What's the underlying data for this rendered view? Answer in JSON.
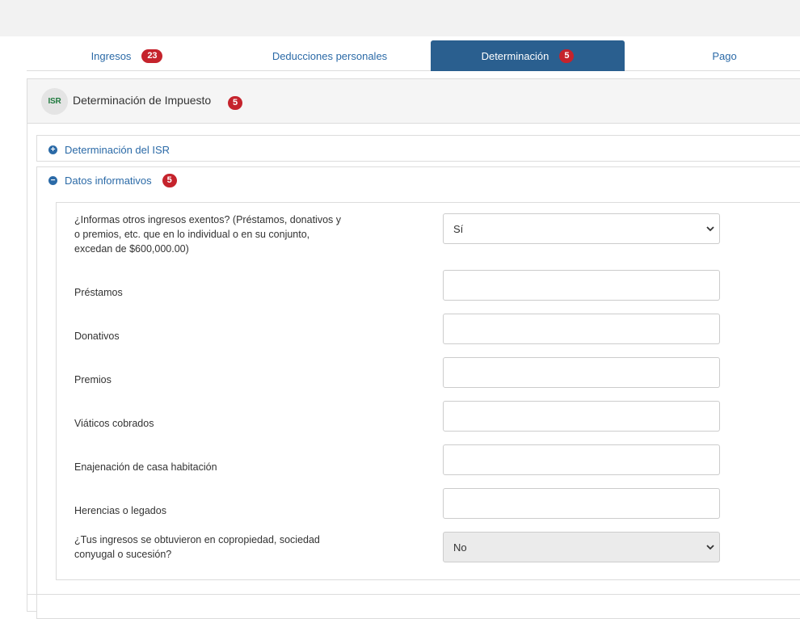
{
  "tabs": [
    {
      "label": "Ingresos",
      "badge": "23"
    },
    {
      "label": "Deducciones personales",
      "badge": ""
    },
    {
      "label": "Determinación",
      "badge": "5"
    },
    {
      "label": "Pago",
      "badge": ""
    }
  ],
  "panel": {
    "icon_text": "ISR",
    "title": "Determinación de Impuesto",
    "badge": "5"
  },
  "sections": {
    "determinacion": {
      "label": "Determinación del ISR",
      "icon": "plus-circle-icon"
    },
    "datos": {
      "label": "Datos informativos",
      "badge": "5",
      "icon": "minus-circle-icon"
    }
  },
  "form": {
    "q_otros": "¿Informas otros ingresos exentos? (Préstamos, donativos y o premios, etc. que en lo individual o en su conjunto, excedan de $600,000.00)",
    "q_otros_value": "Sí",
    "prestamos": "Préstamos",
    "prestamos_value": "",
    "donativos": "Donativos",
    "donativos_value": "",
    "premios": "Premios",
    "premios_value": "",
    "viaticos": "Viáticos cobrados",
    "viaticos_value": "",
    "enajenacion": "Enajenación de casa habitación",
    "enajenacion_value": "",
    "herencias": "Herencias o legados",
    "herencias_value": "",
    "q_copropiedad": "¿Tus ingresos se obtuvieron en copropiedad, sociedad conyugal o sucesión?",
    "q_copropiedad_value": "No"
  },
  "colors": {
    "accent": "#2a5f8f",
    "link": "#2b6aa7",
    "badge": "#c5232c",
    "isr_icon_text": "#1f7a3e"
  }
}
